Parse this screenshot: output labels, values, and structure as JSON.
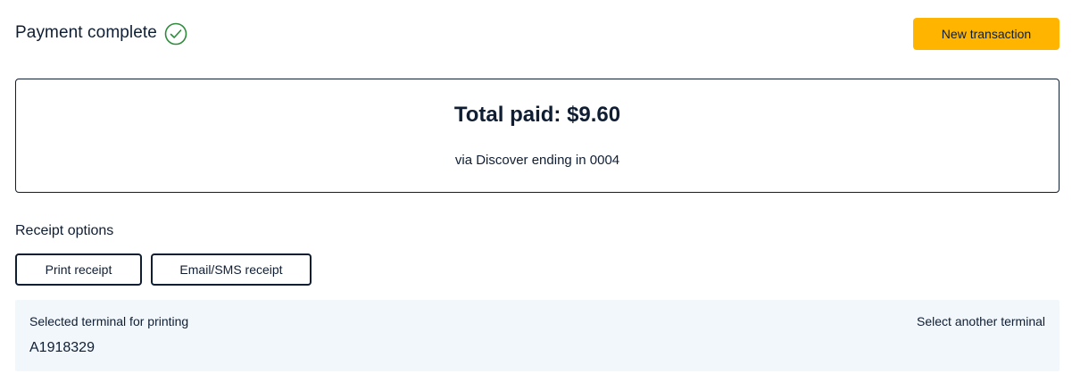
{
  "header": {
    "status_title": "Payment complete",
    "status_icon": "check-circle-icon",
    "new_transaction_label": "New transaction"
  },
  "summary": {
    "total_paid": "Total paid: $9.60",
    "payment_method": "via Discover ending in 0004"
  },
  "receipt": {
    "heading": "Receipt options",
    "print_label": "Print receipt",
    "email_sms_label": "Email/SMS receipt"
  },
  "terminal": {
    "label": "Selected terminal for printing",
    "id": "A1918329",
    "select_another_label": "Select another terminal"
  },
  "colors": {
    "accent": "#ffb500",
    "text": "#0f1e33",
    "success": "#2e8b3a",
    "panel_background": "#f2f7fb"
  }
}
